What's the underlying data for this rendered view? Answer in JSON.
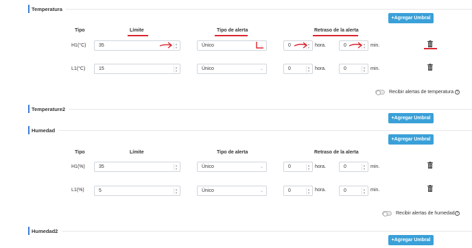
{
  "sections": {
    "temperatura": {
      "title": "Temperatura",
      "add_label": "+Agregar Umbral",
      "headers": {
        "tipo": "Tipo",
        "limite": "Límite",
        "tipo_alerta": "Tipo de alerta",
        "retraso": "Retraso de la alerta"
      },
      "rows": [
        {
          "tipo": "H1(°C)",
          "limit": "35",
          "alert": "Único",
          "hours": "0",
          "hour_unit": "hora.",
          "mins": "0",
          "min_unit": "min."
        },
        {
          "tipo": "L1(°C)",
          "limit": "15",
          "alert": "Único",
          "hours": "0",
          "hour_unit": "hora.",
          "mins": "0",
          "min_unit": "min."
        }
      ],
      "toggle_label": "Recibir alertas de temperatura"
    },
    "temperature2": {
      "title": "Temperature2",
      "add_label": "+Agregar Umbral"
    },
    "humedad": {
      "title": "Humedad",
      "add_label": "+Agregar Umbral",
      "headers": {
        "tipo": "Tipo",
        "limite": "Límite",
        "tipo_alerta": "Tipo de alerta",
        "retraso": "Retraso de la alerta"
      },
      "rows": [
        {
          "tipo": "H1(%)",
          "limit": "35",
          "alert": "Único",
          "hours": "0",
          "hour_unit": "hora.",
          "mins": "0",
          "min_unit": "min."
        },
        {
          "tipo": "L1(%)",
          "limit": "5",
          "alert": "Único",
          "hours": "0",
          "hour_unit": "hora.",
          "mins": "0",
          "min_unit": "min."
        }
      ],
      "toggle_label": "Recibir alertas de humedad"
    },
    "humedad2": {
      "title": "Humedad2",
      "add_label": "+Agregar Umbral"
    }
  },
  "colors": {
    "accent": "#3aa0d8",
    "section_bar": "#3a7bd5",
    "annotation": "#d9232d"
  }
}
